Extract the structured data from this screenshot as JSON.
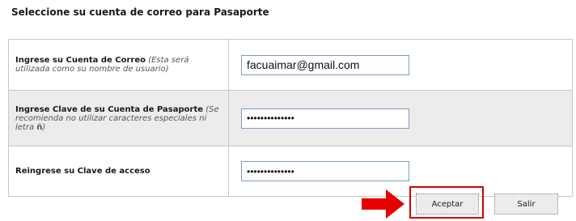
{
  "page": {
    "title": "Seleccione su cuenta de correo para Pasaporte"
  },
  "form": {
    "email": {
      "label": "Ingrese su Cuenta de Correo",
      "hint": "(Esta será utilizada como su nombre de usuario)",
      "value": "facuaimar@gmail.com"
    },
    "password": {
      "label": "Ingrese Clave de su Cuenta de Pasaporte",
      "hint_prefix": "(Se recomienda no utilizar caracteres especiales ni letra ",
      "hint_letter": "ñ",
      "hint_suffix": ")",
      "value": "••••••••••••••"
    },
    "password_confirm": {
      "label": "Reingrese su Clave de acceso",
      "value": "••••••••••••••"
    }
  },
  "actions": {
    "accept_label": "Aceptar",
    "exit_label": "Salir"
  },
  "annotation": {
    "highlight_color": "#d80000",
    "arrow_icon": "arrow-right-icon"
  }
}
